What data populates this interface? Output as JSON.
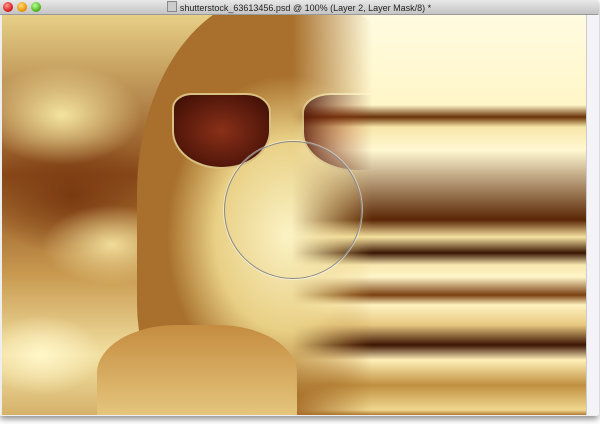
{
  "window": {
    "title": "shutterstock_63613456.psd @ 100% (Layer 2, Layer Mask/8) *",
    "buttons": {
      "close": "close",
      "minimize": "minimize",
      "zoom": "zoom"
    }
  },
  "canvas": {
    "tool": "brush-cursor",
    "colors": {
      "light": "#fff6c8",
      "dark": "#5a2504"
    }
  }
}
